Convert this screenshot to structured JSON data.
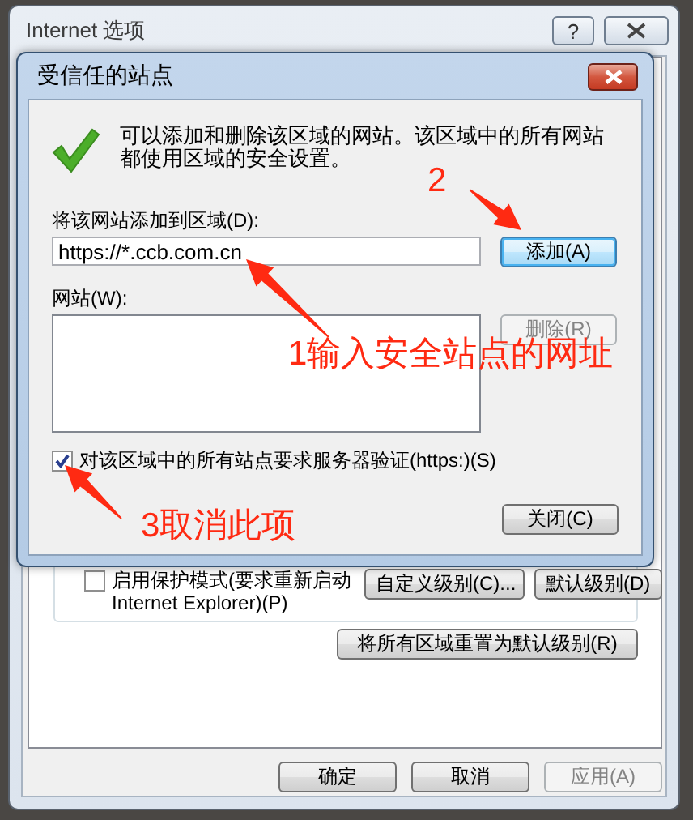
{
  "window": {
    "title": "Internet 选项",
    "help_button": "?"
  },
  "background": {
    "protected_mode": {
      "label": "启用保护模式(要求重新启动 Internet Explorer)(P)",
      "checked": false
    },
    "level_buttons": [
      {
        "label": "自定义级别(C)..."
      },
      {
        "label": "默认级别(D)"
      }
    ],
    "reset_button": "将所有区域重置为默认级别(R)",
    "footer_buttons": [
      {
        "label": "确定",
        "disabled": false
      },
      {
        "label": "取消",
        "disabled": false
      },
      {
        "label": "应用(A)",
        "disabled": true
      }
    ]
  },
  "dialog": {
    "title": "受信任的站点",
    "message": "可以添加和删除该区域的网站。该区域中的所有网站都使用区域的安全设置。",
    "add_label": "将该网站添加到区域(D):",
    "url_value": "https://*.ccb.com.cn",
    "add_button": {
      "label": "添加(A)",
      "disabled": false
    },
    "sites_label": "网站(W):",
    "remove_button": {
      "label": "删除(R)",
      "disabled": true
    },
    "require_https": {
      "label": "对该区域中的所有站点要求服务器验证(https:)(S)",
      "checked": true
    },
    "close_button": "关闭(C)"
  },
  "annotations": [
    {
      "text": "2"
    },
    {
      "text": "1输入安全站点的网址"
    },
    {
      "text": "3取消此项"
    }
  ]
}
